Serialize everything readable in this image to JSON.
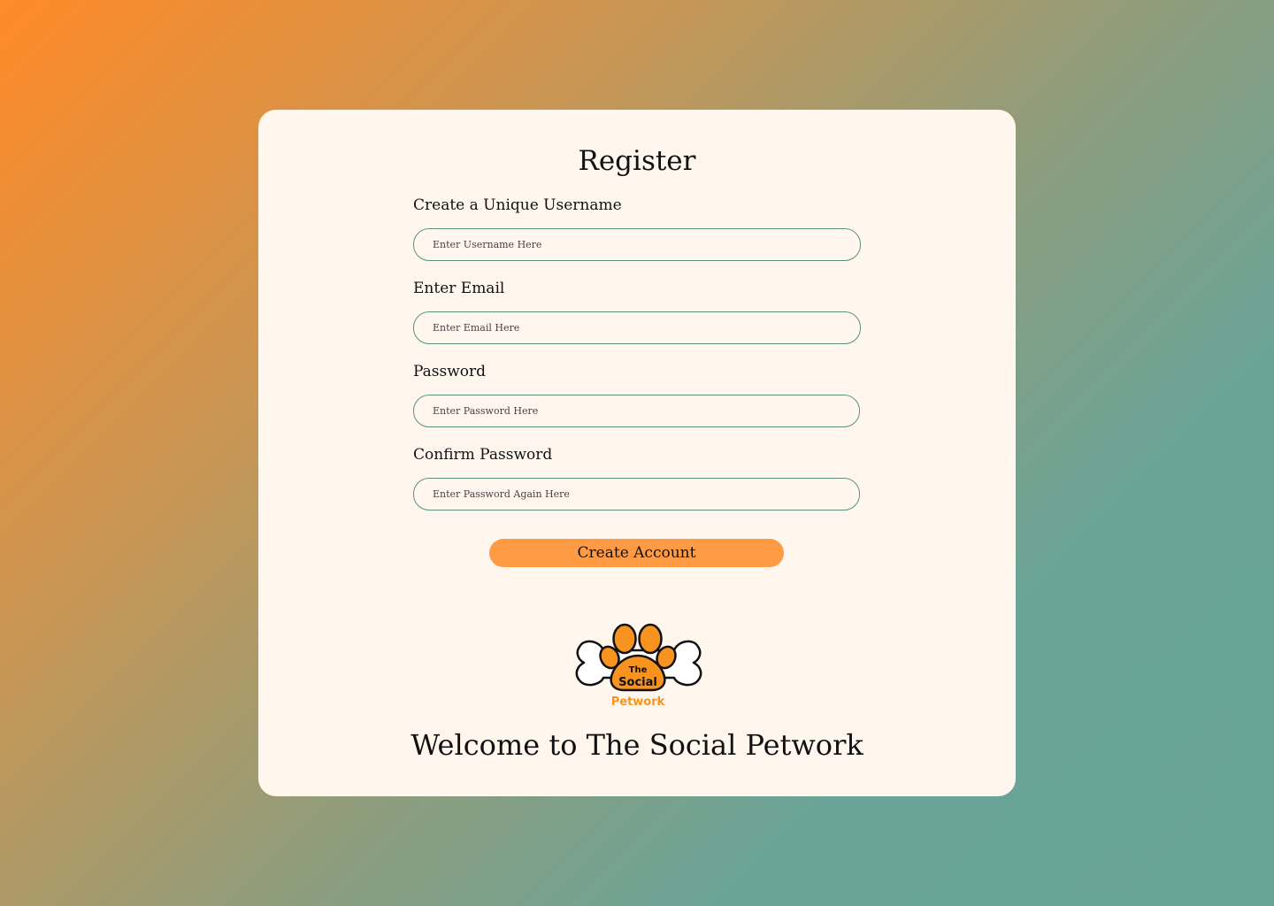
{
  "register": {
    "title": "Register",
    "fields": [
      {
        "label": "Create a Unique Username",
        "placeholder": "Enter Username Here",
        "type": "text"
      },
      {
        "label": "Enter Email",
        "placeholder": "Enter Email Here",
        "type": "email"
      },
      {
        "label": "Password",
        "placeholder": "Enter Password Here",
        "type": "password"
      },
      {
        "label": "Confirm Password",
        "placeholder": "Enter Password Again Here",
        "type": "password"
      }
    ],
    "submit_label": "Create Account"
  },
  "logo": {
    "line1": "The",
    "line2": "Social",
    "line3": "Petwork",
    "icon": "paw-bone-logo-icon"
  },
  "welcome": "Welcome to The Social Petwork",
  "colors": {
    "card_background": "#fff7ee",
    "accent": "#ff9a45",
    "input_border": "#5b927e",
    "logo_orange": "#f7931e"
  }
}
